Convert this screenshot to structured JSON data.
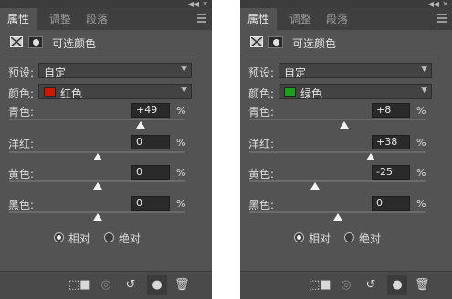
{
  "window": {
    "collapse_glyph": "◀◀",
    "close_glyph": "✕"
  },
  "tabs": [
    "属性",
    "调整",
    "段落"
  ],
  "header": {
    "title": "可选颜色"
  },
  "labels": {
    "preset": "预设:",
    "color": "颜色:",
    "relative": "相对",
    "absolute": "绝对",
    "percent": "%"
  },
  "panels": [
    {
      "preset_value": "自定",
      "color_value": "红色",
      "swatch_color": "#cc1a00",
      "sliders": [
        {
          "label": "青色:",
          "value": "+49",
          "fraction": 0.745
        },
        {
          "label": "洋红:",
          "value": "0",
          "fraction": 0.5
        },
        {
          "label": "黄色:",
          "value": "0",
          "fraction": 0.5
        },
        {
          "label": "黑色:",
          "value": "0",
          "fraction": 0.5
        }
      ],
      "mode": "relative"
    },
    {
      "preset_value": "自定",
      "color_value": "绿色",
      "swatch_color": "#1aa01a",
      "sliders": [
        {
          "label": "青色:",
          "value": "+8",
          "fraction": 0.54
        },
        {
          "label": "洋红:",
          "value": "+38",
          "fraction": 0.69
        },
        {
          "label": "黄色:",
          "value": "-25",
          "fraction": 0.375
        },
        {
          "label": "黑色:",
          "value": "0",
          "fraction": 0.5
        }
      ],
      "mode": "relative"
    }
  ],
  "bottom_icons": [
    "clip-to-layer-icon",
    "view-previous-icon",
    "reset-icon",
    "visibility-eye-icon",
    "trash-icon"
  ]
}
